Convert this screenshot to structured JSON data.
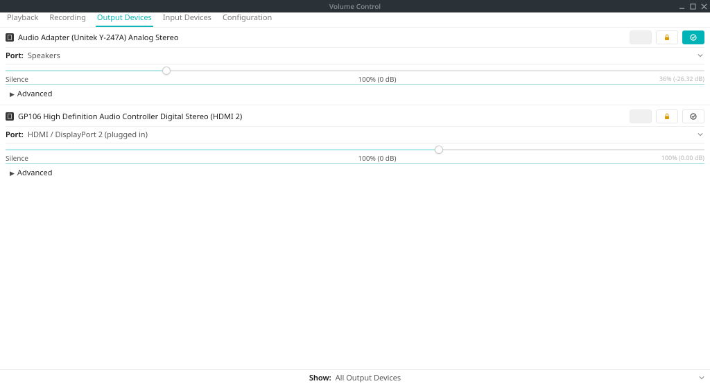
{
  "window": {
    "title": "Volume Control"
  },
  "tabs": [
    {
      "label": "Playback"
    },
    {
      "label": "Recording"
    },
    {
      "label": "Output Devices"
    },
    {
      "label": "Input Devices"
    },
    {
      "label": "Configuration"
    }
  ],
  "active_tab_index": 2,
  "legend": {
    "silence": "Silence",
    "advanced": "Advanced"
  },
  "devices": [
    {
      "name": "Audio Adapter (Unitek Y-247A) Analog Stereo",
      "port_label": "Port:",
      "port_value": "Speakers",
      "volume_percent": 36,
      "mid_label": "100% (0 dB)",
      "right_label": "36% (-26.32 dB)",
      "is_default": true
    },
    {
      "name": "GP106 High Definition Audio Controller Digital Stereo (HDMI 2)",
      "port_label": "Port:",
      "port_value": "HDMI / DisplayPort 2 (plugged in)",
      "volume_percent": 100,
      "mid_label": "100% (0 dB)",
      "right_label": "100% (0.00 dB)",
      "is_default": false
    }
  ],
  "footer": {
    "label": "Show:",
    "value": "All Output Devices"
  }
}
